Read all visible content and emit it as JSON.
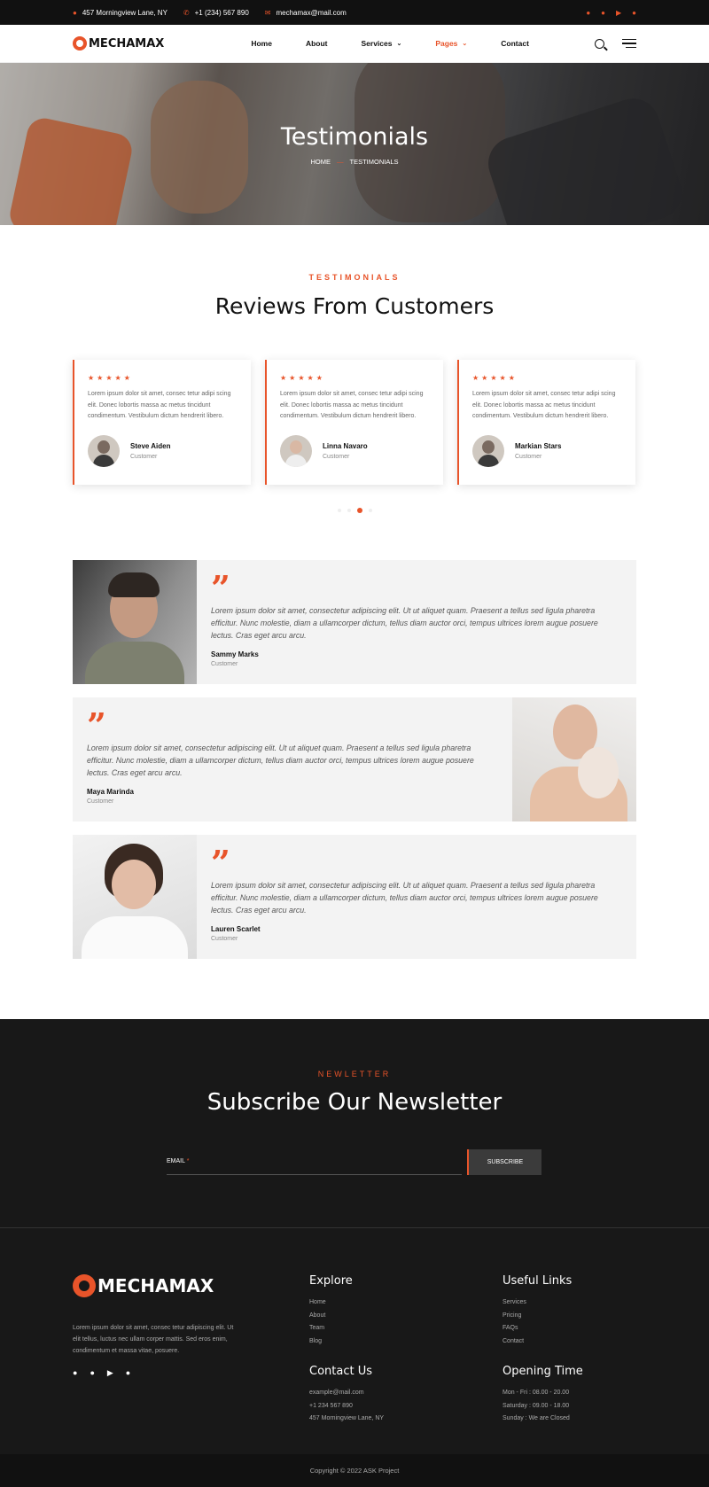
{
  "topbar": {
    "address": "457 Morningview Lane, NY",
    "phone": "+1 (234) 567 890",
    "email": "mechamax@mail.com",
    "socials": [
      "facebook-icon",
      "twitter-icon",
      "youtube-icon",
      "telegram-icon"
    ]
  },
  "header": {
    "logo": "MECHAMAX",
    "nav": [
      {
        "label": "Home"
      },
      {
        "label": "About"
      },
      {
        "label": "Services"
      },
      {
        "label": "Pages"
      },
      {
        "label": "Contact"
      }
    ]
  },
  "hero": {
    "title": "Testimonials",
    "breadcrumb_home": "HOME",
    "breadcrumb_current": "TESTIMONIALS"
  },
  "reviews": {
    "eyebrow": "TESTIMONIALS",
    "title": "Reviews From Customers",
    "cards": [
      {
        "stars": "★★★★★",
        "text": "Lorem ipsum dolor sit amet, consec tetur adipi scing elit. Donec lobortis massa ac metus tincidunt condimentum. Vestibulum dictum hendrerit libero.",
        "name": "Steve Aiden",
        "role": "Customer"
      },
      {
        "stars": "★★★★★",
        "text": "Lorem ipsum dolor sit amet, consec tetur adipi scing elit. Donec lobortis massa ac metus tincidunt condimentum. Vestibulum dictum hendrerit libero.",
        "name": "Linna Navaro",
        "role": "Customer"
      },
      {
        "stars": "★★★★★",
        "text": "Lorem ipsum dolor sit amet, consec tetur adipi scing elit. Donec lobortis massa ac metus tincidunt condimentum. Vestibulum dictum hendrerit libero.",
        "name": "Markian Stars",
        "role": "Customer"
      }
    ]
  },
  "testimonials": [
    {
      "text": "Lorem ipsum dolor sit amet, consectetur adipiscing elit. Ut ut aliquet quam. Praesent a tellus sed ligula pharetra efficitur. Nunc molestie, diam a ullamcorper dictum, tellus diam auctor orci, tempus ultrices lorem augue posuere lectus. Cras eget arcu arcu.",
      "name": "Sammy Marks",
      "role": "Customer"
    },
    {
      "text": "Lorem ipsum dolor sit amet, consectetur adipiscing elit. Ut ut aliquet quam. Praesent a tellus sed ligula pharetra efficitur. Nunc molestie, diam a ullamcorper dictum, tellus diam auctor orci, tempus ultrices lorem augue posuere lectus. Cras eget arcu arcu.",
      "name": "Maya Marinda",
      "role": "Customer"
    },
    {
      "text": "Lorem ipsum dolor sit amet, consectetur adipiscing elit. Ut ut aliquet quam. Praesent a tellus sed ligula pharetra efficitur. Nunc molestie, diam a ullamcorper dictum, tellus diam auctor orci, tempus ultrices lorem augue posuere lectus. Cras eget arcu arcu.",
      "name": "Lauren Scarlet",
      "role": "Customer"
    }
  ],
  "newsletter": {
    "eyebrow": "NEWLETTER",
    "title": "Subscribe Our Newsletter",
    "email_label": "EMAIL",
    "required_mark": "*",
    "button": "SUBSCRIBE"
  },
  "footer": {
    "logo": "MECHAMAX",
    "about": "Lorem ipsum dolor sit amet, consec tetur adipiscing elit. Ut elit tellus, luctus nec ullam corper mattis. Sed eros enim, condimentum et massa vitae, posuere.",
    "explore": {
      "title": "Explore",
      "links": [
        "Home",
        "About",
        "Team",
        "Blog"
      ]
    },
    "useful": {
      "title": "Useful Links",
      "links": [
        "Services",
        "Pricing",
        "FAQs",
        "Contact"
      ]
    },
    "contact": {
      "title": "Contact Us",
      "lines": [
        "example@mail.com",
        "+1 234 567 890",
        "457 Morningview Lane, NY"
      ]
    },
    "hours": {
      "title": "Opening Time",
      "lines": [
        "Mon - Fri : 08.00 - 20.00",
        "Saturday : 09.00 - 18.00",
        "Sunday : We are Closed"
      ]
    },
    "copyright": "Copyright © 2022 ASK Project"
  },
  "colors": {
    "accent": "#e8542a",
    "dark": "#181818"
  }
}
